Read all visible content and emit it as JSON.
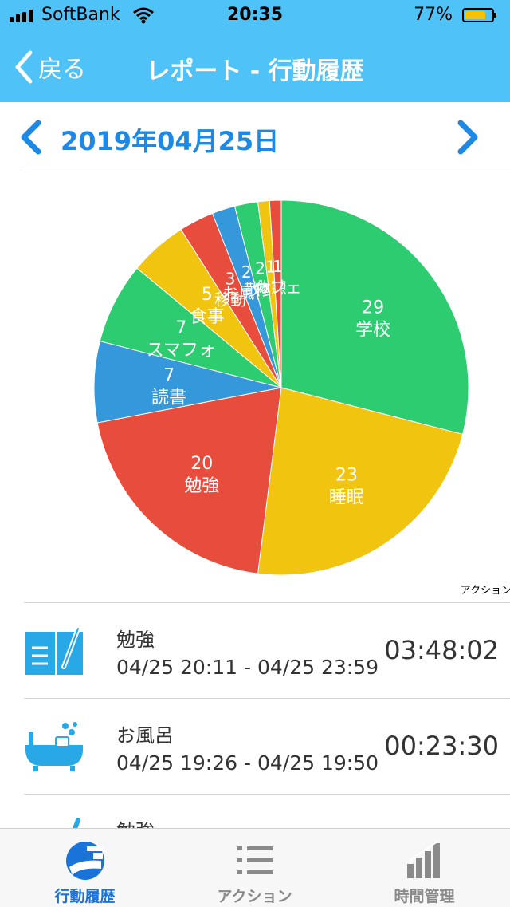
{
  "status_bar": {
    "carrier": "SoftBank",
    "time": "20:35",
    "battery_percent": "77%",
    "battery_level": 0.77
  },
  "nav": {
    "back_label": "戻る",
    "title": "レポート - 行動履歴"
  },
  "date_nav": {
    "date": "2019年04月25日"
  },
  "chart_data": {
    "type": "pie",
    "title": "",
    "legend": "アクション",
    "slices": [
      {
        "label": "学校",
        "value": 29,
        "color": "#2ecc71"
      },
      {
        "label": "睡眠",
        "value": 23,
        "color": "#f1c40f"
      },
      {
        "label": "勉強",
        "value": 20,
        "color": "#e74c3c"
      },
      {
        "label": "読書",
        "value": 7,
        "color": "#3498db"
      },
      {
        "label": "スマフォ",
        "value": 7,
        "color": "#2ecc71"
      },
      {
        "label": "食事",
        "value": 5,
        "color": "#f1c40f"
      },
      {
        "label": "移動",
        "value": 3,
        "color": "#e74c3c"
      },
      {
        "label": "お風呂",
        "value": 2,
        "color": "#3498db"
      },
      {
        "label": "散歩",
        "value": 2,
        "color": "#2ecc71"
      },
      {
        "label": "休憩",
        "value": 1,
        "color": "#f1c40f"
      },
      {
        "label": "カフェ",
        "value": 1,
        "color": "#e74c3c"
      }
    ]
  },
  "history": [
    {
      "name": "勉強",
      "range": "04/25 20:11 - 04/25 23:59",
      "duration": "03:48:02",
      "icon": "notebook-icon"
    },
    {
      "name": "お風呂",
      "range": "04/25 19:26 - 04/25 19:50",
      "duration": "00:23:30",
      "icon": "bathtub-icon"
    },
    {
      "name": "勉強",
      "range": "",
      "duration": "",
      "icon": "notebook-icon"
    }
  ],
  "tabs": [
    {
      "label": "行動履歴",
      "icon": "history-icon",
      "active": true
    },
    {
      "label": "アクション",
      "icon": "list-icon",
      "active": false
    },
    {
      "label": "時間管理",
      "icon": "bar-chart-icon",
      "active": false
    }
  ],
  "colors": {
    "accent": "#4fc3f7",
    "date_blue": "#1e88e5",
    "icon_blue": "#29a8e8",
    "tab_active": "#1a73d9",
    "tab_inactive": "#8a8a8a"
  }
}
